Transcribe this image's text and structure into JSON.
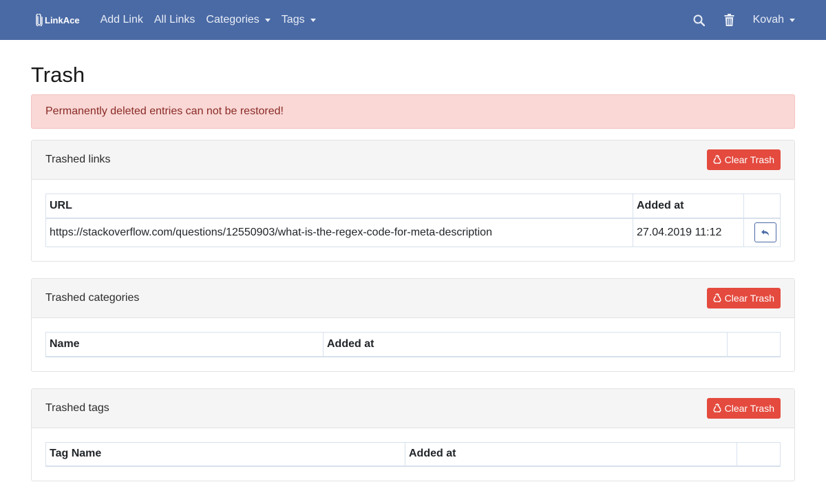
{
  "nav": {
    "brand": "LinkAce",
    "add_link": "Add Link",
    "all_links": "All Links",
    "categories": "Categories",
    "tags": "Tags",
    "user": "Kovah",
    "search_icon": "search-icon",
    "trash_icon": "trash-icon"
  },
  "page": {
    "title": "Trash"
  },
  "alert": {
    "text": "Permanently deleted entries can not be restored!"
  },
  "links_card": {
    "title": "Trashed links",
    "clear_label": "Clear Trash",
    "columns": [
      "URL",
      "Added at",
      ""
    ],
    "rows": [
      {
        "url": "https://stackoverflow.com/questions/12550903/what-is-the-regex-code-for-meta-description",
        "added_at": "27.04.2019 11:12"
      }
    ]
  },
  "categories_card": {
    "title": "Trashed categories",
    "clear_label": "Clear Trash",
    "columns": [
      "Name",
      "Added at",
      ""
    ]
  },
  "tags_card": {
    "title": "Trashed tags",
    "clear_label": "Clear Trash",
    "columns": [
      "Tag Name",
      "Added at",
      ""
    ]
  },
  "colors": {
    "navbar": "#4a6aa5",
    "danger": "#e44a3e",
    "alert_bg": "#f9d8d6",
    "alert_text": "#8a2a25"
  }
}
